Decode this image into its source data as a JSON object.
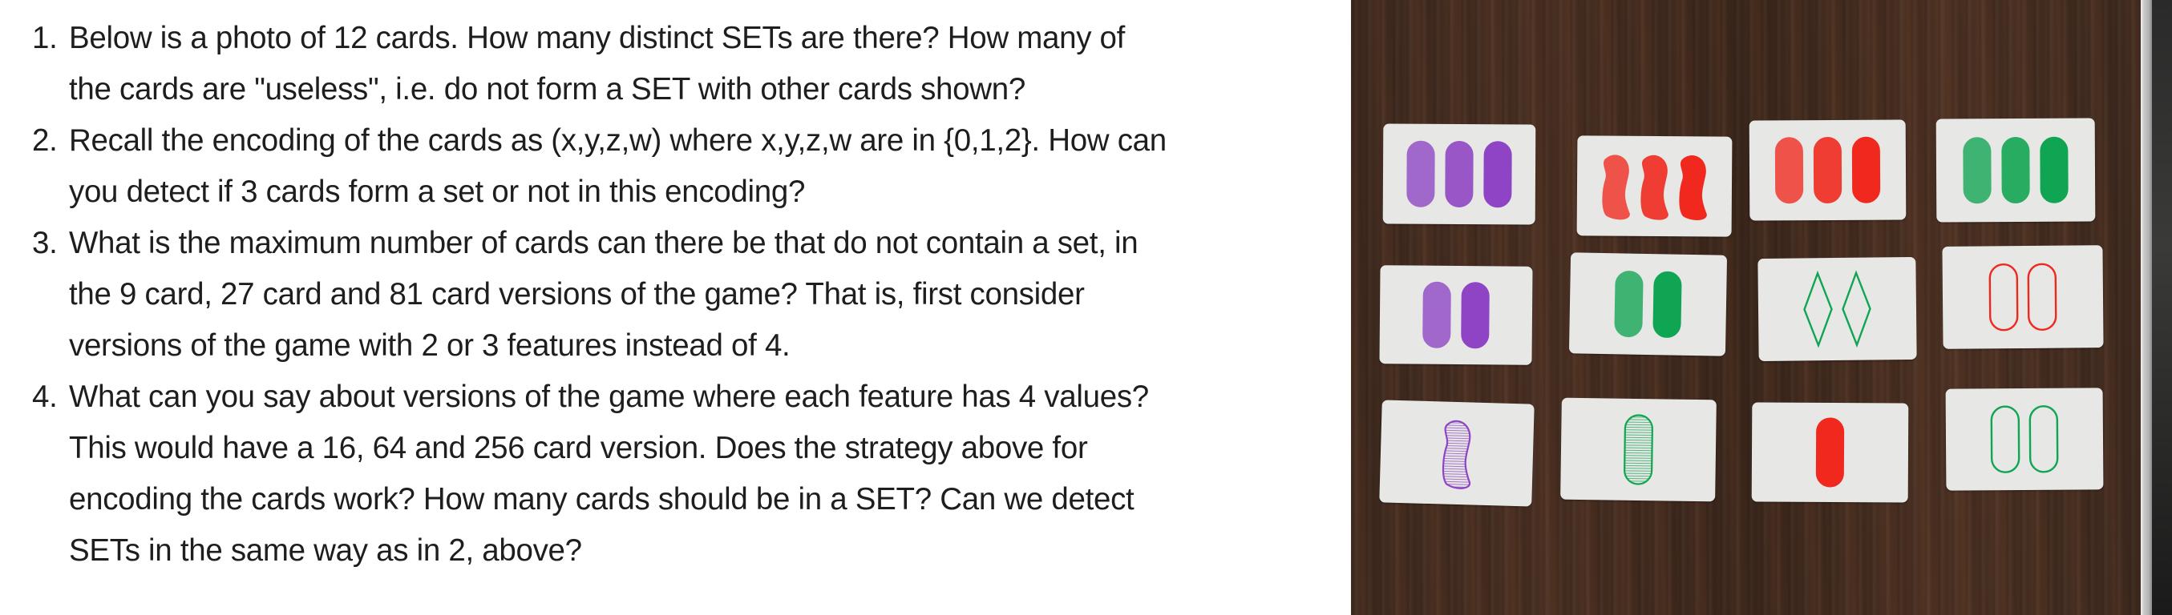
{
  "questions": [
    {
      "number": "1.",
      "lines": [
        "Below is a photo of 12 cards.  How many distinct SETs are there?  How many of",
        "the cards are \"useless\", i.e. do not form a SET with other cards shown?"
      ]
    },
    {
      "number": "2.",
      "lines": [
        "Recall the encoding of the cards as (x,y,z,w) where x,y,z,w are in {0,1,2}.  How can",
        "you detect if 3 cards form a set or not in this encoding?"
      ]
    },
    {
      "number": "3.",
      "lines": [
        "What is the maximum number of cards can there be that do not contain a set, in",
        "the 9 card, 27 card and 81 card versions of the game?  That is, first consider",
        "versions of the game with 2 or 3 features instead of 4."
      ]
    },
    {
      "number": "4.",
      "lines": [
        "What can you say about versions of the game where each feature has 4 values?",
        "This would have a 16, 64 and 256 card version.  Does the strategy above for",
        "encoding the cards work?  How many cards should be in a SET? Can we detect",
        "SETs in the same way as in 2, above?"
      ]
    }
  ],
  "photo": {
    "description": "Photo of 12 SET cards on a wooden table",
    "colors": {
      "purple": "#8e44c4",
      "red": "#f0281e",
      "green": "#10a552"
    },
    "cards": [
      {
        "row": 1,
        "col": 1,
        "count": 3,
        "color": "purple",
        "shape": "oval",
        "shading": "solid"
      },
      {
        "row": 1,
        "col": 2,
        "count": 3,
        "color": "red",
        "shape": "squiggle",
        "shading": "solid"
      },
      {
        "row": 1,
        "col": 3,
        "count": 3,
        "color": "red",
        "shape": "oval",
        "shading": "solid"
      },
      {
        "row": 1,
        "col": 4,
        "count": 3,
        "color": "green",
        "shape": "oval",
        "shading": "solid"
      },
      {
        "row": 2,
        "col": 1,
        "count": 2,
        "color": "purple",
        "shape": "oval",
        "shading": "solid"
      },
      {
        "row": 2,
        "col": 2,
        "count": 2,
        "color": "green",
        "shape": "oval",
        "shading": "solid"
      },
      {
        "row": 2,
        "col": 3,
        "count": 2,
        "color": "green",
        "shape": "diamond",
        "shading": "open"
      },
      {
        "row": 2,
        "col": 4,
        "count": 2,
        "color": "red",
        "shape": "oval",
        "shading": "open"
      },
      {
        "row": 3,
        "col": 1,
        "count": 1,
        "color": "purple",
        "shape": "squiggle",
        "shading": "striped"
      },
      {
        "row": 3,
        "col": 2,
        "count": 1,
        "color": "green",
        "shape": "oval",
        "shading": "striped"
      },
      {
        "row": 3,
        "col": 3,
        "count": 1,
        "color": "red",
        "shape": "oval",
        "shading": "solid"
      },
      {
        "row": 3,
        "col": 4,
        "count": 2,
        "color": "green",
        "shape": "oval",
        "shading": "open"
      }
    ]
  }
}
